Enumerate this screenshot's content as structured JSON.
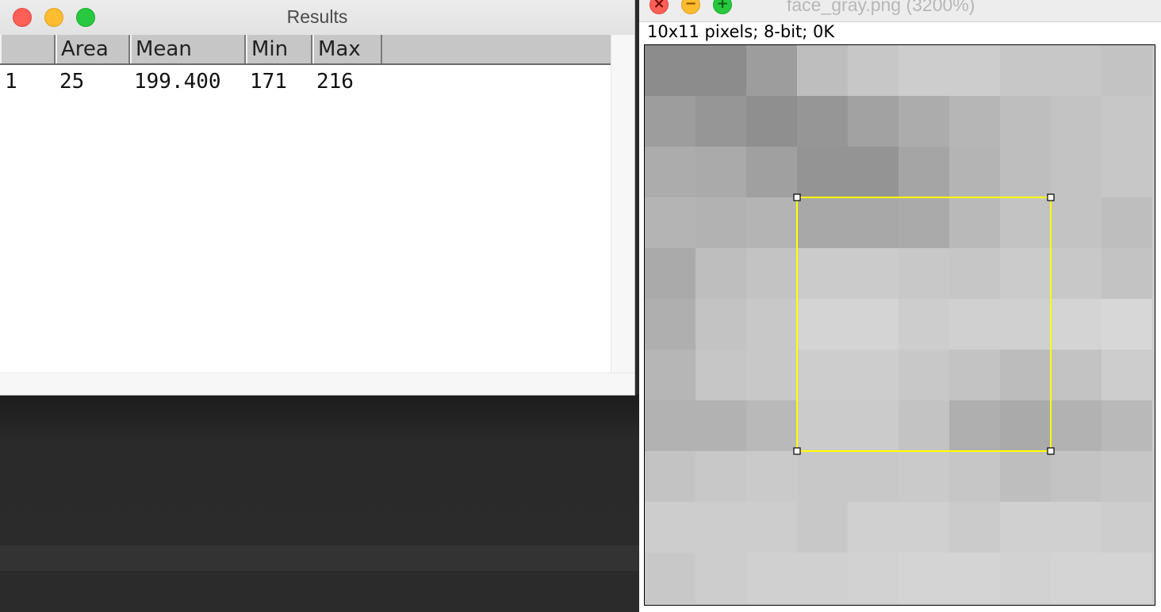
{
  "results_window": {
    "title": "Results",
    "columns": [
      "",
      "Area",
      "Mean",
      "Min",
      "Max"
    ],
    "rows": [
      [
        "1",
        "25",
        "199.400",
        "171",
        "216"
      ]
    ]
  },
  "image_window": {
    "title": "face_gray.png (3200%)",
    "info": "10x11 pixels; 8-bit; 0K",
    "close_icon": "×",
    "minimize_icon": "−",
    "maximize_icon": "+",
    "roi_color": "#ffff00",
    "pixels": [
      [
        140,
        140,
        157,
        190,
        199,
        205,
        205,
        199,
        199,
        195
      ],
      [
        157,
        150,
        143,
        150,
        162,
        172,
        182,
        190,
        195,
        199
      ],
      [
        172,
        170,
        160,
        148,
        148,
        165,
        180,
        190,
        195,
        199
      ],
      [
        180,
        178,
        180,
        168,
        168,
        170,
        185,
        195,
        195,
        190
      ],
      [
        170,
        190,
        195,
        203,
        203,
        200,
        198,
        203,
        200,
        195
      ],
      [
        175,
        195,
        200,
        212,
        212,
        205,
        208,
        208,
        212,
        215
      ],
      [
        182,
        198,
        200,
        205,
        205,
        200,
        195,
        188,
        195,
        205
      ],
      [
        178,
        178,
        185,
        203,
        203,
        195,
        175,
        170,
        178,
        185
      ],
      [
        195,
        200,
        202,
        200,
        200,
        202,
        198,
        190,
        195,
        198
      ],
      [
        205,
        205,
        205,
        200,
        208,
        208,
        203,
        208,
        208,
        205
      ],
      [
        200,
        205,
        208,
        208,
        210,
        212,
        212,
        210,
        212,
        212
      ]
    ],
    "roi": {
      "x": 3,
      "y": 3,
      "width": 5,
      "height": 5
    }
  }
}
